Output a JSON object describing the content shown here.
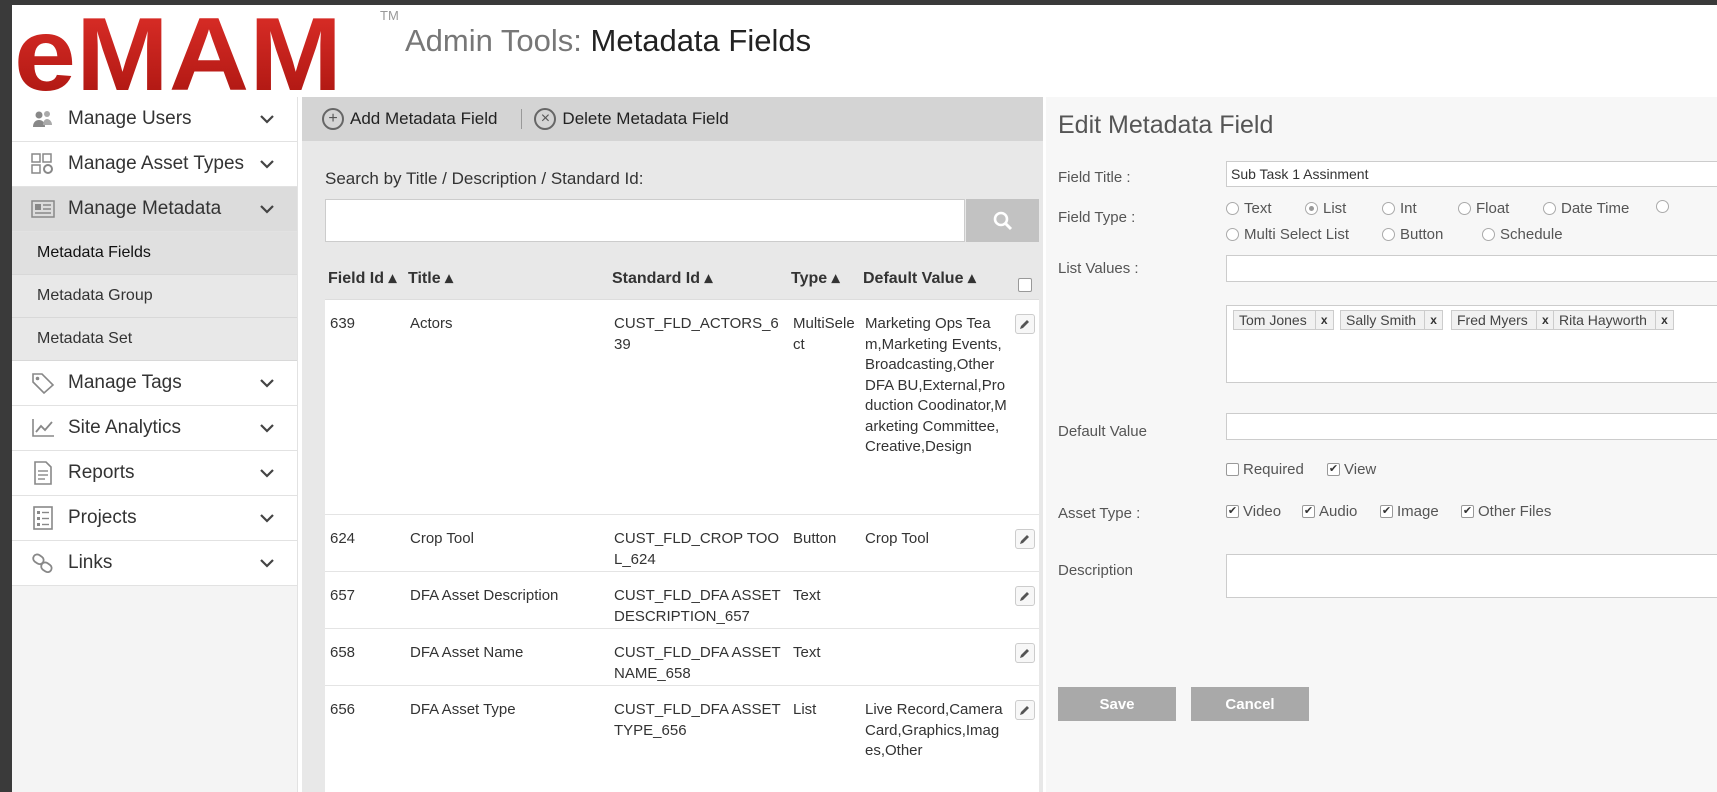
{
  "header": {
    "logo_text": "eMAM",
    "tm": "TM",
    "title_prefix": "Admin Tools:",
    "title_main": "Metadata Fields"
  },
  "sidebar": {
    "items": [
      {
        "label": "Manage Users",
        "icon": "users-icon"
      },
      {
        "label": "Manage Asset Types",
        "icon": "asset-types-icon"
      },
      {
        "label": "Manage Metadata",
        "icon": "metadata-icon"
      },
      {
        "label": "Manage Tags",
        "icon": "tag-icon"
      },
      {
        "label": "Site Analytics",
        "icon": "analytics-icon"
      },
      {
        "label": "Reports",
        "icon": "report-icon"
      },
      {
        "label": "Projects",
        "icon": "projects-icon"
      },
      {
        "label": "Links",
        "icon": "link-icon"
      }
    ],
    "submenu": [
      "Metadata Fields",
      "Metadata Group",
      "Metadata Set"
    ]
  },
  "toolbar": {
    "add_label": "Add Metadata Field",
    "delete_label": "Delete Metadata Field"
  },
  "search": {
    "label": "Search by Title / Description / Standard Id:",
    "value": ""
  },
  "table": {
    "headers": [
      "Field Id ▴",
      "Title ▴",
      "Standard Id ▴",
      "Type ▴",
      "Default Value ▴"
    ],
    "rows": [
      {
        "id": "639",
        "title": "Actors",
        "std": "CUST_FLD_ACTORS_639",
        "type": "MultiSelect",
        "def": "Marketing Ops Team,Marketing Events,Broadcasting,Other DFA BU,External,Production Coodinator,Marketing Committee,Creative,Design"
      },
      {
        "id": "624",
        "title": "Crop Tool",
        "std": "CUST_FLD_CROP TOOL_624",
        "type": "Button",
        "def": "Crop Tool"
      },
      {
        "id": "657",
        "title": "DFA Asset Description",
        "std": "CUST_FLD_DFA ASSET DESCRIPTION_657",
        "type": "Text",
        "def": ""
      },
      {
        "id": "658",
        "title": "DFA Asset Name",
        "std": "CUST_FLD_DFA ASSET NAME_658",
        "type": "Text",
        "def": ""
      },
      {
        "id": "656",
        "title": "DFA Asset Type",
        "std": "CUST_FLD_DFA ASSET TYPE_656",
        "type": "List",
        "def": "Live Record,Camera Card,Graphics,Images,Other"
      }
    ]
  },
  "edit": {
    "title": "Edit Metadata Field",
    "field_title_label": "Field Title :",
    "field_title_value": "Sub Task 1 Assinment",
    "field_type_label": "Field Type :",
    "field_types": [
      "Text",
      "List",
      "Int",
      "Float",
      "Date Time",
      "Multi Select List",
      "Button",
      "Schedule"
    ],
    "field_type_selected": "List",
    "list_values_label": "List Values :",
    "list_value_input": "",
    "list_tags": [
      "Tom Jones",
      "Sally Smith",
      "Fred Myers",
      "Rita Hayworth"
    ],
    "tag_remove": "x",
    "default_value_label": "Default Value",
    "default_value": "",
    "required_label": "Required",
    "required_checked": false,
    "view_label": "View",
    "view_checked": true,
    "asset_type_label": "Asset Type :",
    "asset_types": [
      "Video",
      "Audio",
      "Image",
      "Other Files"
    ],
    "description_label": "Description",
    "description_value": "",
    "save_label": "Save",
    "cancel_label": "Cancel"
  },
  "colors": {
    "logo_red": "#cc1f1a",
    "button_gray": "#a9a9a9",
    "active_nav": "#dcdcdc"
  }
}
